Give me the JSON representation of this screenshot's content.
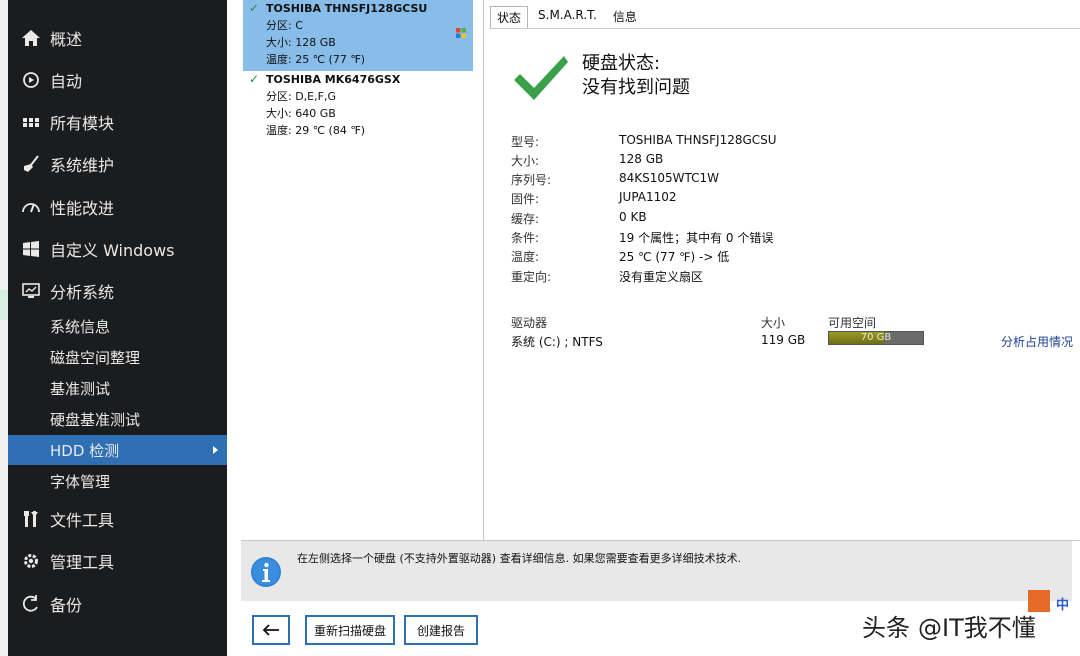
{
  "sidebar": {
    "nav": [
      {
        "icon": "home-icon",
        "label": "概述"
      },
      {
        "icon": "auto-icon",
        "label": "自动"
      },
      {
        "icon": "grid-icon",
        "label": "所有模块"
      },
      {
        "icon": "broom-icon",
        "label": "系统维护"
      },
      {
        "icon": "gauge-icon",
        "label": "性能改进"
      },
      {
        "icon": "windows-icon",
        "label": "自定义 Windows"
      },
      {
        "icon": "monitor-icon",
        "label": "分析系统"
      }
    ],
    "sub": [
      {
        "label": "系统信息"
      },
      {
        "label": "磁盘空间整理"
      },
      {
        "label": "基准测试"
      },
      {
        "label": "硬盘基准测试"
      },
      {
        "label": "HDD 检测",
        "active": true
      },
      {
        "label": "字体管理"
      }
    ],
    "nav2": [
      {
        "icon": "tools-icon",
        "label": "文件工具"
      },
      {
        "icon": "gear-icon",
        "label": "管理工具"
      },
      {
        "icon": "backup-icon",
        "label": "备份"
      }
    ]
  },
  "disks": [
    {
      "name": "TOSHIBA THNSFJ128GCSU",
      "partition": "分区: C",
      "size": "大小: 128 GB",
      "temp": "温度: 25 ℃ (77 ℉)",
      "selected": true
    },
    {
      "name": "TOSHIBA MK6476GSX",
      "partition": "分区: D,E,F,G",
      "size": "大小: 640 GB",
      "temp": "温度: 29 ℃ (84 ℉)",
      "selected": false
    }
  ],
  "tabs": [
    "状态",
    "S.M.A.R.T.",
    "信息"
  ],
  "status": {
    "label": "硬盘状态:",
    "value": "没有找到问题"
  },
  "properties": [
    {
      "label": "型号:",
      "value": "TOSHIBA THNSFJ128GCSU"
    },
    {
      "label": "大小:",
      "value": "128 GB"
    },
    {
      "label": "序列号:",
      "value": "84KS105WTC1W"
    },
    {
      "label": "固件:",
      "value": "JUPA1102"
    },
    {
      "label": "缓存:",
      "value": "0 KB"
    },
    {
      "label": "条件:",
      "value": "19 个属性；其中有 0 个错误"
    },
    {
      "label": "温度:",
      "value": "25 ℃ (77 ℉) -> 低"
    },
    {
      "label": "重定向:",
      "value": "没有重定义扇区"
    }
  ],
  "drives": {
    "header": {
      "name": "驱动器",
      "size": "大小",
      "free": "可用空间"
    },
    "row": {
      "name": "系统 (C:) ; NTFS",
      "size": "119 GB",
      "free": "70 GB",
      "free_fraction": 0.59
    },
    "link": "分析占用情况"
  },
  "info": "在左侧选择一个硬盘 (不支持外置驱动器) 查看详细信息. 如果您需要查看更多详细技术技术.",
  "buttons": {
    "rescan": "重新扫描硬盘",
    "report": "创建报告"
  },
  "watermark": {
    "prefix": "头条",
    "handle": "@IT我不懂",
    "zh": "中"
  }
}
